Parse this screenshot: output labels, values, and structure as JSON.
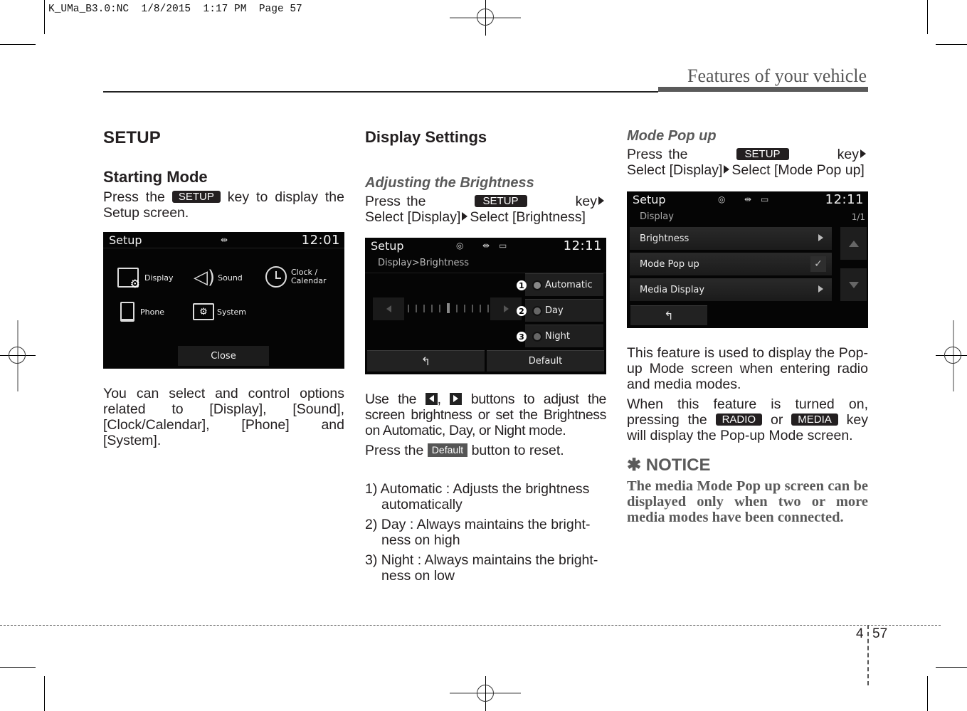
{
  "slug": "K_UMa_B3.0:NC  1/8/2015  1:17 PM  Page 57",
  "running_head": "Features of your vehicle",
  "folio": {
    "chapter": "4",
    "page": "57"
  },
  "col1": {
    "section_title": "SETUP",
    "subsection_title": "Starting Mode",
    "intro_pre": "Press the",
    "intro_key": "SETUP",
    "intro_post": "key to display the Setup screen.",
    "screen": {
      "title": "Setup",
      "time": "12:01",
      "status_icons": [
        "usb-icon"
      ],
      "items": [
        {
          "label": "Display",
          "icon": "display-gear-icon"
        },
        {
          "label": "Sound",
          "icon": "speaker-icon"
        },
        {
          "label_line1": "Clock /",
          "label_line2": "Calendar",
          "icon": "clock-icon"
        },
        {
          "label": "Phone",
          "icon": "phone-icon"
        },
        {
          "label": "System",
          "icon": "folder-gear-icon"
        }
      ],
      "close_label": "Close"
    },
    "description": "You can select and control options related to [Display], [Sound], [Clock/Calendar], [Phone] and [System]."
  },
  "col2": {
    "section_title": "Display Settings",
    "subsection_title": "Adjusting the Brightness",
    "path_pre": "Press the",
    "path_key": "SETUP",
    "path_key_word": "key",
    "path_select1": "Select [Display]",
    "path_select2": "Select [Brightness]",
    "screen": {
      "title": "Setup",
      "time": "12:11",
      "status_icons": [
        "disc-icon",
        "usb-icon",
        "aux-icon"
      ],
      "breadcrumb": "Display>Brightness",
      "brightness_level": 6,
      "brightness_steps": 11,
      "options": [
        {
          "num": "1",
          "label": "Automatic"
        },
        {
          "num": "2",
          "label": "Day"
        },
        {
          "num": "3",
          "label": "Night"
        }
      ],
      "default_label": "Default"
    },
    "use_pre": "Use the",
    "use_sep": ",",
    "use_post": "buttons to adjust the screen brightness or set the Brightness on Automatic, Day, or Night mode.",
    "reset_pre": "Press the",
    "reset_key": "Default",
    "reset_post": "button to reset.",
    "steps": [
      "1) Automatic : Adjusts the brightness automatically",
      "2) Day : Always maintains the bright-ness on high",
      "3) Night : Always maintains the bright-ness on low"
    ]
  },
  "col3": {
    "subsection_title": "Mode Pop up",
    "path_pre": "Press the",
    "path_key": "SETUP",
    "path_key_word": "key",
    "path_select1": "Select [Display]",
    "path_select2": "Select [Mode Pop up]",
    "screen": {
      "title": "Setup",
      "time": "12:11",
      "status_icons": [
        "disc-icon",
        "usb-icon",
        "aux-icon"
      ],
      "list_title": "Display",
      "page_indicator": "1/1",
      "rows": [
        {
          "label": "Brightness",
          "end": "arrow"
        },
        {
          "label": "Mode Pop up",
          "end": "check",
          "checked": true
        },
        {
          "label": "Media Display",
          "end": "arrow"
        }
      ]
    },
    "para1": "This feature is used to display the Pop-up Mode screen when entering radio and media modes.",
    "para2_pre": "When this feature is turned on, pressing the",
    "para2_key1": "RADIO",
    "para2_mid": "or",
    "para2_key2": "MEDIA",
    "para2_post": "key will display the Pop-up Mode screen.",
    "notice_title": "✱ NOTICE",
    "notice_body": "The media Mode Pop up screen can be displayed only when two or more media modes have been connected."
  }
}
